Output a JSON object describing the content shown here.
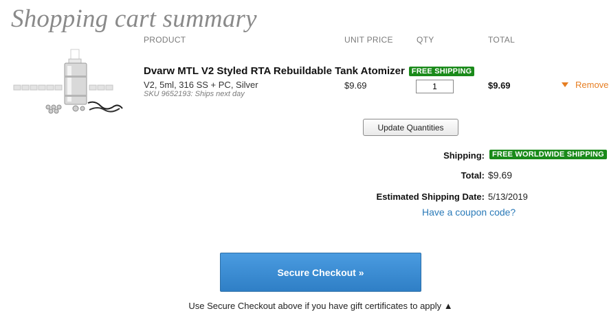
{
  "page": {
    "title": "Shopping cart summary"
  },
  "table": {
    "headers": {
      "product": "PRODUCT",
      "unit_price": "UNIT PRICE",
      "qty": "QTY",
      "total": "TOTAL"
    }
  },
  "item": {
    "name": "Dvarw MTL V2 Styled RTA Rebuildable Tank Atomizer",
    "badge": "FREE SHIPPING",
    "variant": "V2, 5ml, 316 SS + PC, Silver",
    "sku": "SKU 9652193: Ships next day",
    "unit_price": "$9.69",
    "qty": "1",
    "total": "$9.69",
    "remove_label": "Remove",
    "image_icon": "product-atomizer-photo"
  },
  "buttons": {
    "update": "Update Quantities",
    "checkout": "Secure Checkout »"
  },
  "summary": {
    "shipping_label": "Shipping:",
    "shipping_value": "FREE WORLDWIDE SHIPPING",
    "total_label": "Total:",
    "total_value": "$9.69",
    "est_label": "Estimated Shipping Date:",
    "est_value": "5/13/2019",
    "coupon": "Have a coupon code?"
  },
  "footer": {
    "gift_note": "Use Secure Checkout above if you have gift certificates to apply ▲"
  },
  "colors": {
    "badge_green": "#1a8a1a",
    "remove_orange": "#e67e22",
    "link_blue": "#2a7ab8",
    "checkout_blue": "#3a8bd2"
  }
}
